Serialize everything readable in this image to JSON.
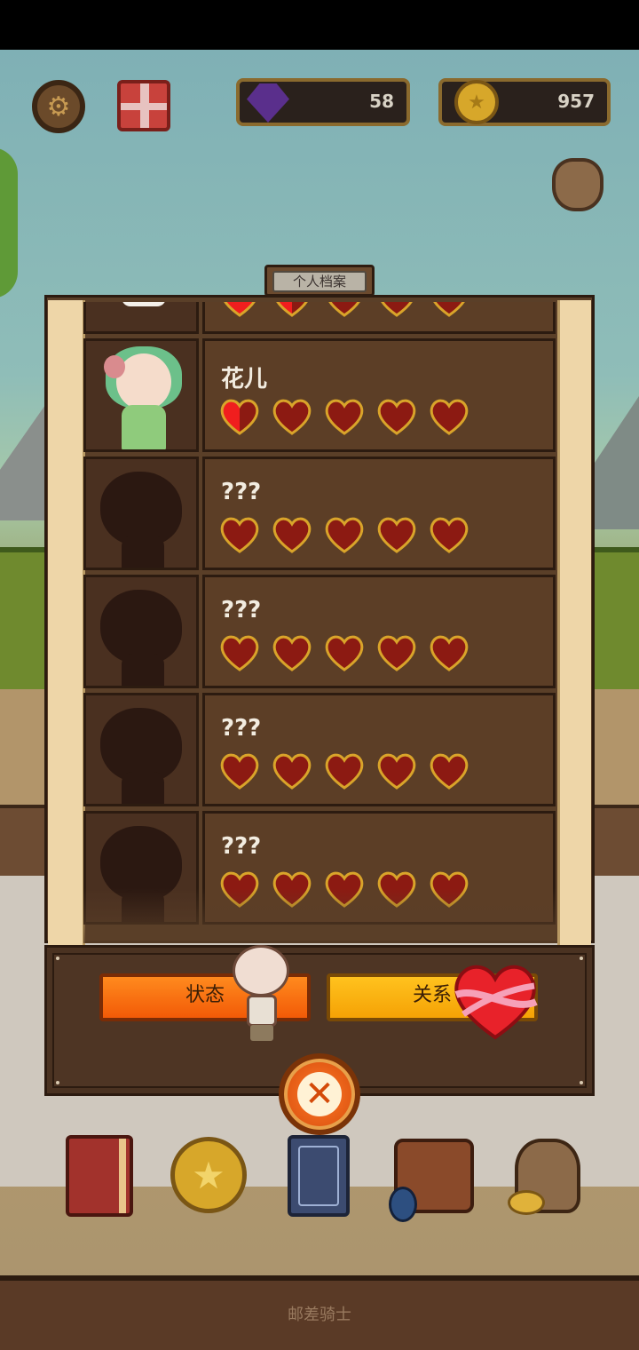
{
  "hud": {
    "gems": "58",
    "gold": "957"
  },
  "panel": {
    "tab_title": "个人档案"
  },
  "characters": [
    {
      "name": "",
      "silhouette": false,
      "hair": "blue",
      "affection_hearts": 1.5,
      "max_hearts": 5
    },
    {
      "name": "花儿",
      "silhouette": false,
      "hair": "green",
      "affection_hearts": 0.5,
      "max_hearts": 5
    },
    {
      "name": "???",
      "silhouette": true,
      "affection_hearts": 0,
      "max_hearts": 5
    },
    {
      "name": "???",
      "silhouette": true,
      "affection_hearts": 0,
      "max_hearts": 5
    },
    {
      "name": "???",
      "silhouette": true,
      "affection_hearts": 0,
      "max_hearts": 5
    },
    {
      "name": "???",
      "silhouette": true,
      "affection_hearts": 0,
      "max_hearts": 5
    }
  ],
  "buttons": {
    "status": "状态",
    "relation": "关系"
  },
  "dock": {
    "items": [
      "book-icon",
      "coin-icon",
      "card-icon",
      "bag-icon",
      "loot-icon"
    ]
  },
  "watermark": "邮差骑士",
  "colors": {
    "heart_filled": "#f01e1e",
    "heart_empty": "#8c1a12",
    "heart_outline": "#d9a42a",
    "status_button": "#f25a07",
    "relation_button": "#f5a205"
  }
}
